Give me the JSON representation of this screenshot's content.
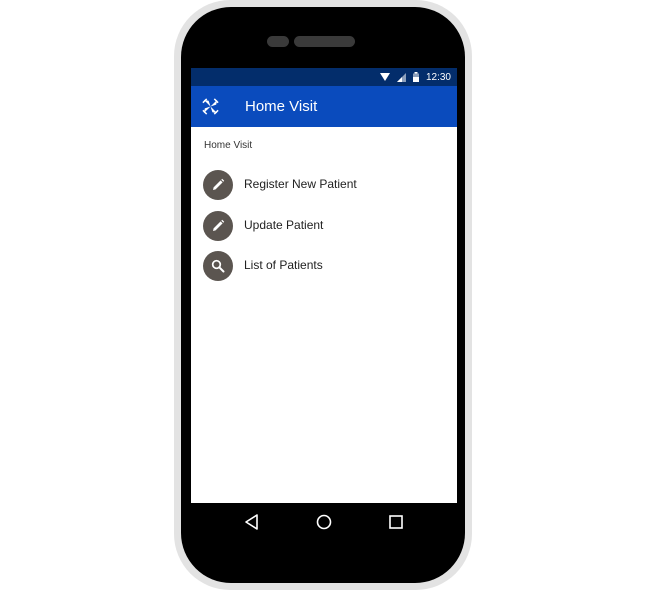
{
  "status_bar": {
    "time": "12:30",
    "icons": [
      "wifi-icon",
      "signal-icon",
      "battery-icon"
    ]
  },
  "app_bar": {
    "logo_icon": "app-logo-icon",
    "title": "Home Visit"
  },
  "content": {
    "section_label": "Home Visit",
    "menu_items": [
      {
        "label": "Register New Patient",
        "icon": "pencil-icon"
      },
      {
        "label": "Update Patient",
        "icon": "pencil-icon"
      },
      {
        "label": "List of Patients",
        "icon": "search-icon"
      }
    ]
  },
  "nav_bar": {
    "buttons": [
      "back-icon",
      "home-icon",
      "recents-icon"
    ]
  },
  "colors": {
    "status_bar": "#032d6b",
    "app_bar": "#0a4bbd",
    "menu_icon_bg": "#5b5550",
    "phone_frame": "#000000",
    "phone_outline": "#e3e3e3"
  }
}
